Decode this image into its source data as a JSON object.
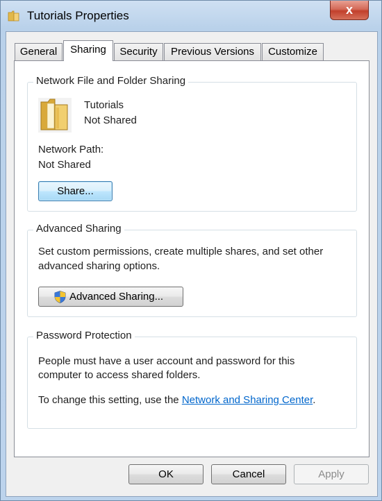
{
  "window": {
    "title": "Tutorials Properties",
    "close_glyph": "x"
  },
  "tabs": [
    {
      "label": "General",
      "active": false
    },
    {
      "label": "Sharing",
      "active": true
    },
    {
      "label": "Security",
      "active": false
    },
    {
      "label": "Previous Versions",
      "active": false
    },
    {
      "label": "Customize",
      "active": false
    }
  ],
  "network_sharing": {
    "group_label": "Network File and Folder Sharing",
    "folder_icon": "folder-icon",
    "folder_name": "Tutorials",
    "folder_status": "Not Shared",
    "network_path_label": "Network Path:",
    "network_path_value": "Not Shared",
    "share_button": "Share..."
  },
  "advanced_sharing": {
    "group_label": "Advanced Sharing",
    "description_line1": "Set custom permissions, create multiple shares, and set other",
    "description_line2": "advanced sharing options.",
    "button_label": "Advanced Sharing...",
    "button_icon": "uac-shield-icon"
  },
  "password_protection": {
    "group_label": "Password Protection",
    "description_line1": "People must have a user account and password for this",
    "description_line2": "computer to access shared folders.",
    "change_text": "To change this setting, use the ",
    "link_text": "Network and Sharing Center",
    "trailing_text": "."
  },
  "footer": {
    "ok": "OK",
    "cancel": "Cancel",
    "apply": "Apply"
  },
  "colors": {
    "link": "#0066cc",
    "close_button": "#c2402c",
    "focused_button_border": "#3c7fb1"
  }
}
